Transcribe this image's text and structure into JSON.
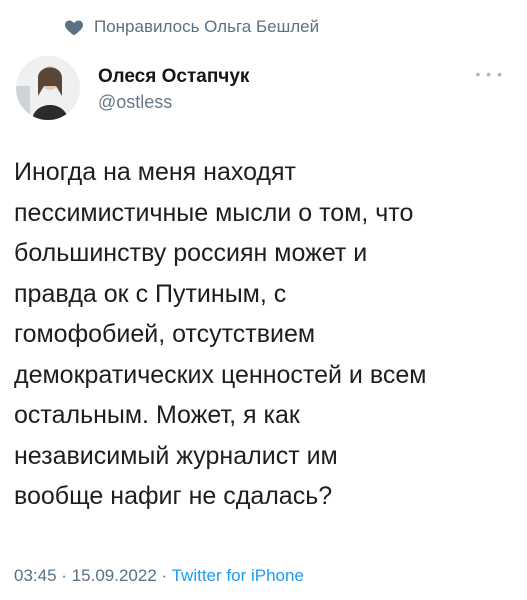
{
  "liked_by": {
    "text": "Понравилось Ольга Бешлей",
    "icon": "heart-icon"
  },
  "author": {
    "name": "Олеся Остапчук",
    "handle": "@ostless"
  },
  "more_icon": "more-horizontal-icon",
  "tweet": {
    "text": "Иногда на меня находят\nпессимистичные мысли о том, что\nбольшинству россиян может и\nправда ок с Путиным, с\nгомофобией, отсутствием\nдемократических ценностей и всем\nостальным. Может, я как\nнезависимый журналист им\nвообще нафиг не сдалась?"
  },
  "meta": {
    "time": "03:45",
    "separator": "·",
    "date": "15.09.2022",
    "source": "Twitter for iPhone"
  },
  "colors": {
    "muted": "#5b7083",
    "link": "#1d9bf0",
    "text": "#1c1e21"
  }
}
